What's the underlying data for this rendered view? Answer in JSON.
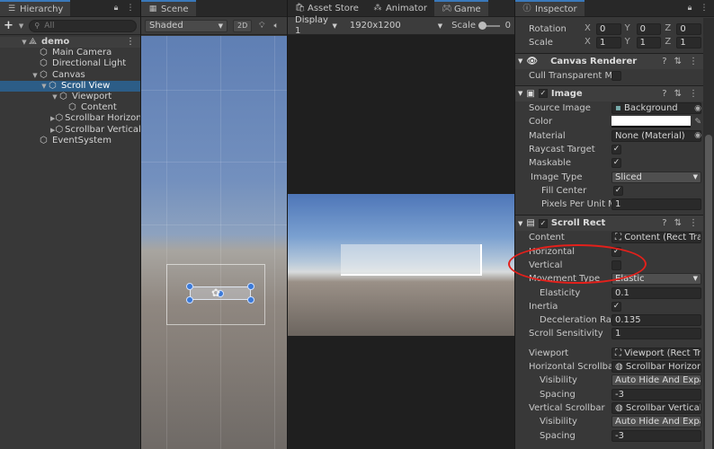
{
  "hierarchy": {
    "tab_label": "Hierarchy",
    "add_label": "+",
    "search_placeholder": "All",
    "items": [
      {
        "label": "demo",
        "indent": 0
      },
      {
        "label": "Main Camera",
        "indent": 1
      },
      {
        "label": "Directional Light",
        "indent": 1
      },
      {
        "label": "Canvas",
        "indent": 1
      },
      {
        "label": "Scroll View",
        "indent": 2
      },
      {
        "label": "Viewport",
        "indent": 3
      },
      {
        "label": "Content",
        "indent": 4
      },
      {
        "label": "Scrollbar Horizont",
        "indent": 3
      },
      {
        "label": "Scrollbar Vertical",
        "indent": 3
      },
      {
        "label": "EventSystem",
        "indent": 1
      }
    ]
  },
  "scene": {
    "tab_label": "Scene",
    "shading_mode": "Shaded",
    "btn_2d": "2D"
  },
  "game": {
    "tabs": [
      "Asset Store",
      "Animator",
      "Game"
    ],
    "display": "Display 1",
    "resolution": "1920x1200",
    "scale_label": "Scale",
    "scale_value": "0"
  },
  "inspector": {
    "tab_label": "Inspector",
    "rotation": {
      "label": "Rotation",
      "x": "0",
      "y": "0",
      "z": "0"
    },
    "scale": {
      "label": "Scale",
      "x": "1",
      "y": "1",
      "z": "1"
    },
    "canvas_renderer": {
      "title": "Canvas Renderer",
      "cull_label": "Cull Transparent Mes"
    },
    "image": {
      "title": "Image",
      "source_image_label": "Source Image",
      "source_image_value": "Background",
      "color_label": "Color",
      "material_label": "Material",
      "material_value": "None (Material)",
      "raycast_label": "Raycast Target",
      "maskable_label": "Maskable",
      "image_type_label": "Image Type",
      "image_type_value": "Sliced",
      "fill_center_label": "Fill Center",
      "ppu_label": "Pixels Per Unit Mul",
      "ppu_value": "1"
    },
    "scroll_rect": {
      "title": "Scroll Rect",
      "content_label": "Content",
      "content_value": "Content (Rect Tra",
      "horizontal_label": "Horizontal",
      "vertical_label": "Vertical",
      "movement_label": "Movement Type",
      "movement_value": "Elastic",
      "elasticity_label": "Elasticity",
      "elasticity_value": "0.1",
      "inertia_label": "Inertia",
      "decel_label": "Deceleration Rate",
      "decel_value": "0.135",
      "sensitivity_label": "Scroll Sensitivity",
      "sensitivity_value": "1",
      "viewport_label": "Viewport",
      "viewport_value": "Viewport (Rect Tr",
      "hscroll_label": "Horizontal Scrollbar",
      "hscroll_value": "Scrollbar Horizon",
      "visibility_label": "Visibility",
      "visibility_value": "Auto Hide And Expa",
      "spacing_label": "Spacing",
      "spacing_value": "-3",
      "vscroll_label": "Vertical Scrollbar",
      "vscroll_value": "Scrollbar Vertical",
      "v_visibility_label": "Visibility",
      "v_visibility_value": "Auto Hide And Expa",
      "v_spacing_label": "Spacing",
      "v_spacing_value": "-3"
    }
  },
  "colors": {
    "selection": "#2c5d87",
    "annotation": "#e3201b",
    "accent": "#3a79bb"
  }
}
